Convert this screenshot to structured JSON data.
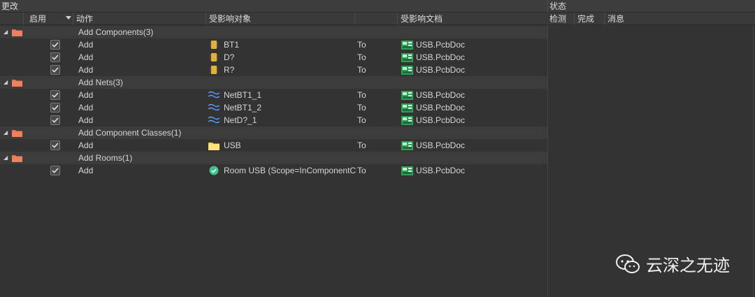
{
  "header": {
    "group_changes": "更改",
    "group_status": "状态",
    "col_enable": "启用",
    "col_action": "动作",
    "col_object": "受影响对象",
    "col_document": "受影响文档",
    "col_check": "检测",
    "col_done": "完成",
    "col_message": "消息"
  },
  "rows": [
    {
      "type": "group",
      "label": "Add Components(3)"
    },
    {
      "type": "item",
      "action": "Add",
      "icon": "component-icon",
      "object": "BT1",
      "to": "To",
      "doc": "USB.PcbDoc",
      "checked": true
    },
    {
      "type": "item",
      "action": "Add",
      "icon": "component-icon",
      "object": "D?",
      "to": "To",
      "doc": "USB.PcbDoc",
      "checked": true
    },
    {
      "type": "item",
      "action": "Add",
      "icon": "component-icon",
      "object": "R?",
      "to": "To",
      "doc": "USB.PcbDoc",
      "checked": true
    },
    {
      "type": "group",
      "label": "Add Nets(3)"
    },
    {
      "type": "item",
      "action": "Add",
      "icon": "net-icon",
      "object": "NetBT1_1",
      "to": "To",
      "doc": "USB.PcbDoc",
      "checked": true
    },
    {
      "type": "item",
      "action": "Add",
      "icon": "net-icon",
      "object": "NetBT1_2",
      "to": "To",
      "doc": "USB.PcbDoc",
      "checked": true
    },
    {
      "type": "item",
      "action": "Add",
      "icon": "net-icon",
      "object": "NetD?_1",
      "to": "To",
      "doc": "USB.PcbDoc",
      "checked": true
    },
    {
      "type": "group",
      "label": "Add Component Classes(1)"
    },
    {
      "type": "item",
      "action": "Add",
      "icon": "class-folder-icon",
      "object": "USB",
      "to": "To",
      "doc": "USB.PcbDoc",
      "checked": true
    },
    {
      "type": "group",
      "label": "Add Rooms(1)"
    },
    {
      "type": "item",
      "action": "Add",
      "icon": "room-icon",
      "object": "Room USB (Scope=InComponentClas",
      "to": "To",
      "doc": "USB.PcbDoc",
      "checked": true
    }
  ],
  "watermark": {
    "text": "云深之无迹",
    "icon": "wechat-icon"
  },
  "colors": {
    "folder": "#e8704a",
    "net": "#5aa0ff",
    "component": "#e0b040",
    "room": "#3cc28a",
    "doc": "#2fa05a",
    "background": "#333333"
  }
}
